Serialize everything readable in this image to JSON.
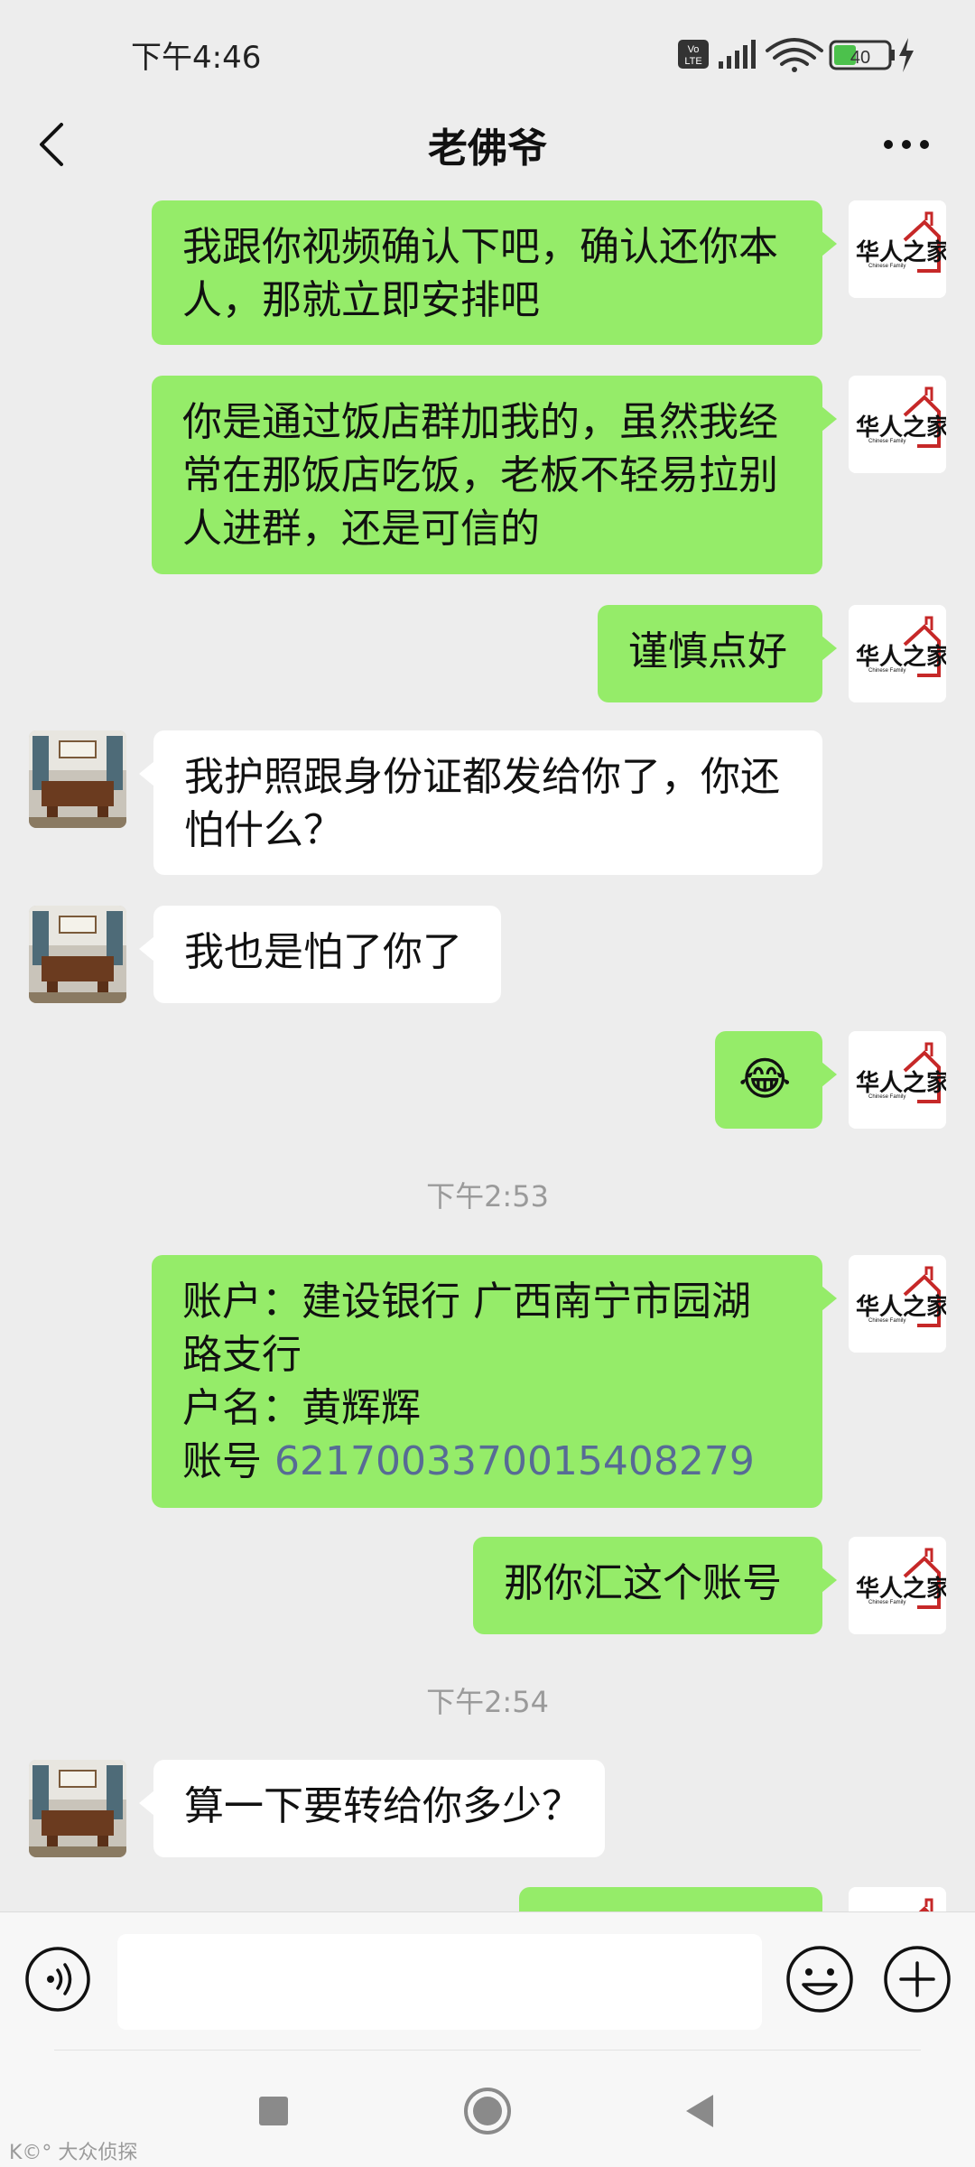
{
  "status_bar": {
    "time": "下午4:46",
    "battery": "40",
    "network_badge": "Vo LTE"
  },
  "header": {
    "title": "老佛爷",
    "back_icon": "chevron-left-icon",
    "more_icon": "ellipsis-icon"
  },
  "messages": {
    "m1": {
      "lines": [
        "我跟你视频确认下吧，确认还你本",
        "人，那就立即安排吧"
      ]
    },
    "m2": {
      "lines": [
        "你是通过饭店群加我的，虽然我经",
        "常在那饭店吃饭，老板不轻易拉别",
        "人进群，还是可信的"
      ]
    },
    "m3": {
      "text": "谨慎点好"
    },
    "m4": {
      "lines": [
        "我护照跟身份证都发给你了，你还",
        "怕什么？"
      ]
    },
    "m5": {
      "text": "我也是怕了你了"
    },
    "m6": {
      "emoji": "😂"
    },
    "ts1": "下午2:53",
    "m7": {
      "line1": "账户：建设银行  广西南宁市园湖",
      "line2": "路支行",
      "line3": "户名：黄辉辉",
      "account_label": "账号 ",
      "account_number": "6217003370015408279"
    },
    "m8": {
      "text": "那你汇这个账号"
    },
    "ts2": "下午2:54",
    "m9": {
      "text": "算一下要转给你多少？"
    }
  },
  "input_bar": {
    "placeholder": ""
  },
  "watermark": "K©° 大众侦探",
  "colors": {
    "sent_bubble": "#95ec69",
    "received_bubble": "#ffffff",
    "background": "#ededed",
    "link": "#576b95"
  }
}
